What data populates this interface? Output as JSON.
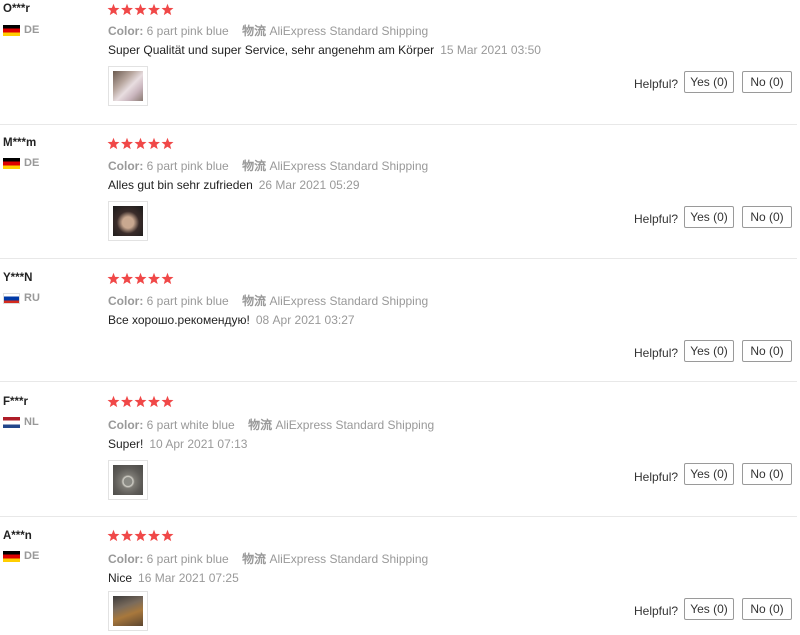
{
  "helpful_label": "Helpful?",
  "star_color": "#f04848",
  "reviews": [
    {
      "user": "O***r",
      "country": "DE",
      "color_label": "Color:",
      "color_value": "6 part pink blue",
      "ship_label": "物流",
      "ship_value": "AliExpress Standard Shipping",
      "text": "Super Qualität und super Service, sehr angenehm am Körper",
      "date": "15 Mar 2021 03:50",
      "rating": 5,
      "has_photo": true,
      "yes_label": "Yes (0)",
      "no_label": "No (0)"
    },
    {
      "user": "M***m",
      "country": "DE",
      "color_label": "Color:",
      "color_value": "6 part pink blue",
      "ship_label": "物流",
      "ship_value": "AliExpress Standard Shipping",
      "text": "Alles gut bin sehr zufrieden",
      "date": "26 Mar 2021 05:29",
      "rating": 5,
      "has_photo": true,
      "yes_label": "Yes (0)",
      "no_label": "No (0)"
    },
    {
      "user": "Y***N",
      "country": "RU",
      "color_label": "Color:",
      "color_value": "6 part pink blue",
      "ship_label": "物流",
      "ship_value": "AliExpress Standard Shipping",
      "text": "Все хорошо.рекомендую!",
      "date": "08 Apr 2021 03:27",
      "rating": 5,
      "has_photo": false,
      "yes_label": "Yes (0)",
      "no_label": "No (0)"
    },
    {
      "user": "F***r",
      "country": "NL",
      "color_label": "Color:",
      "color_value": "6 part white blue",
      "ship_label": "物流",
      "ship_value": "AliExpress Standard Shipping",
      "text": "Super!",
      "date": "10 Apr 2021 07:13",
      "rating": 5,
      "has_photo": true,
      "yes_label": "Yes (0)",
      "no_label": "No (0)"
    },
    {
      "user": "A***n",
      "country": "DE",
      "color_label": "Color:",
      "color_value": "6 part pink blue",
      "ship_label": "物流",
      "ship_value": "AliExpress Standard Shipping",
      "text": "Nice",
      "date": "16 Mar 2021 07:25",
      "rating": 5,
      "has_photo": true,
      "yes_label": "Yes (0)",
      "no_label": "No (0)"
    }
  ]
}
